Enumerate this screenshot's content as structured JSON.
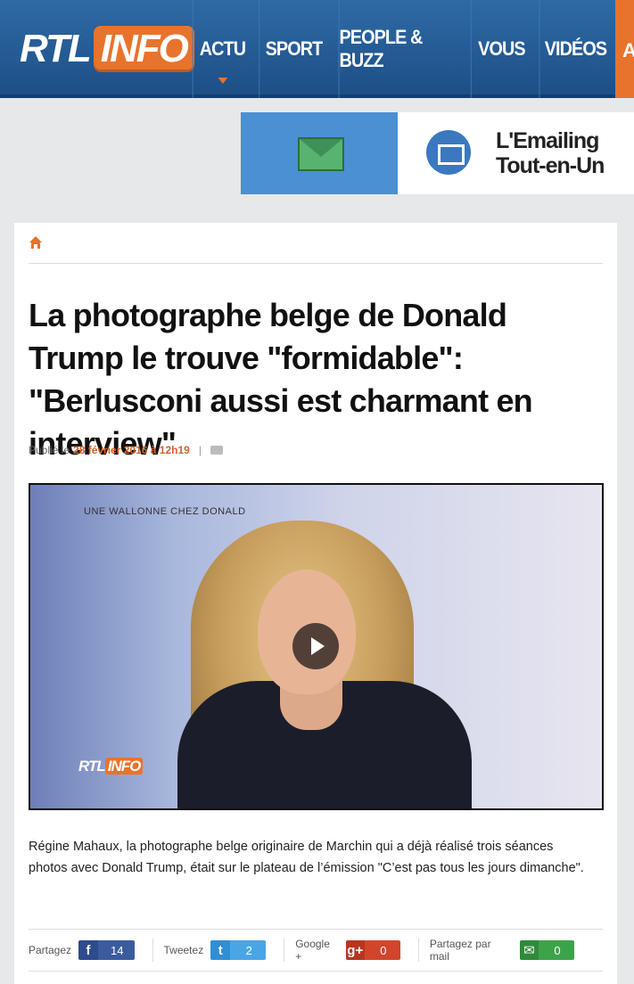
{
  "header": {
    "logo_rtl": "RTL",
    "logo_info": "INFO",
    "nav": [
      {
        "label": "ACTU",
        "active": true
      },
      {
        "label": "SPORT",
        "active": false
      },
      {
        "label": "PEOPLE & BUZZ",
        "active": false
      },
      {
        "label": "VOUS",
        "active": false
      },
      {
        "label": "VIDÉOS",
        "active": false
      }
    ],
    "nav_partial": "A"
  },
  "ad": {
    "line1": "L'Emailing",
    "line2": "Tout-en-Un"
  },
  "article": {
    "title": "La photographe belge de Donald Trump le trouve \"formidable\": \"Berlusconi aussi est charmant en interview\"",
    "published_prefix": "Publié le",
    "published_date": "28 février 2016 à 12h19",
    "meta_separator": "|",
    "video_caption": "UNE WALLONNE CHEZ DONALD",
    "video_logo_rtl": "RTL",
    "video_logo_info": "INFO",
    "lead": "Régine Mahaux, la photographe belge originaire de Marchin qui a déjà réalisé trois séances photos avec Donald Trump, était sur le plateau de l’émission \"C’est pas tous les jours dimanche\"."
  },
  "share": {
    "facebook": {
      "label": "Partagez",
      "icon": "f",
      "count": "14"
    },
    "twitter": {
      "label": "Tweetez",
      "icon": "t",
      "count": "2"
    },
    "google": {
      "label": "Google +",
      "icon": "g+",
      "count": "0"
    },
    "mail": {
      "label": "Partagez par mail",
      "icon": "✉",
      "count": "0"
    }
  },
  "colors": {
    "nav_blue": "#2f6aa6",
    "accent_orange": "#e8732c"
  }
}
